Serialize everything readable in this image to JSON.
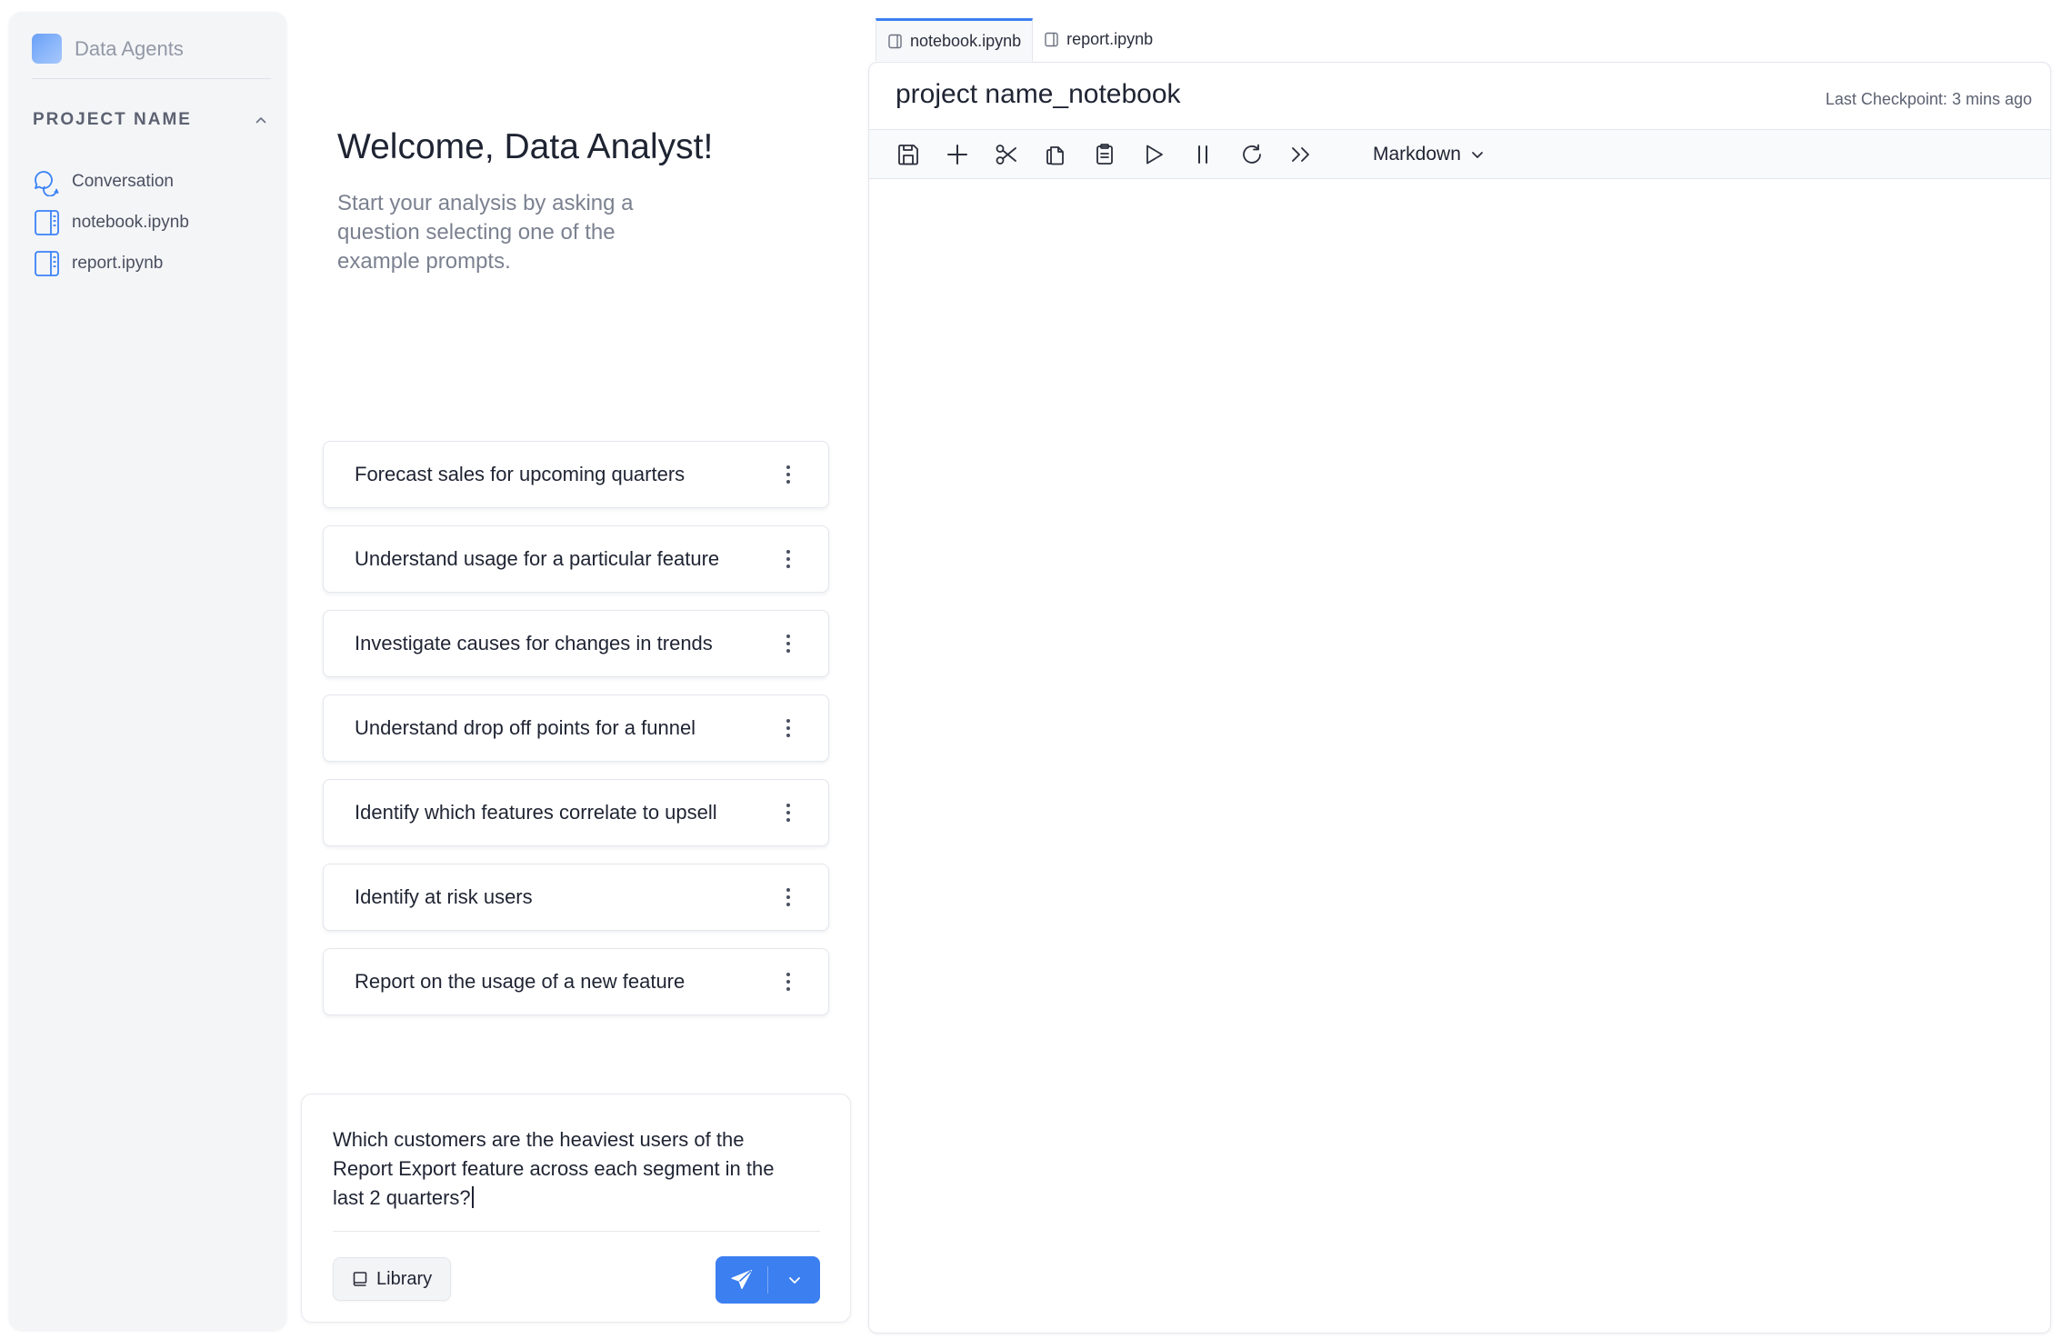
{
  "sidebar": {
    "brand": "Data Agents",
    "project_name": "PROJECT NAME",
    "items": [
      {
        "label": "Conversation",
        "icon": "chat-bubbles-icon"
      },
      {
        "label": "notebook.ipynb",
        "icon": "notebook-icon"
      },
      {
        "label": "report.ipynb",
        "icon": "notebook-icon"
      }
    ]
  },
  "conversation": {
    "title": "Welcome, Data Analyst!",
    "subtitle": "Start your analysis by asking a question selecting one of the example prompts.",
    "prompts": [
      "Forecast sales for upcoming quarters",
      "Understand usage for a particular feature",
      "Investigate causes for changes in trends",
      "Understand drop off points for a funnel",
      "Identify which features correlate to upsell",
      "Identify at risk users",
      "Report on the usage of a new feature"
    ],
    "composer": {
      "value": "Which customers are the heaviest users of the Report Export feature across each segment in the last 2 quarters?",
      "library_label": "Library"
    }
  },
  "notebook": {
    "tabs": [
      "notebook.ipynb",
      "report.ipynb"
    ],
    "active_tab": "notebook.ipynb",
    "title": "project name_notebook",
    "checkpoint": "Last Checkpoint: 3 mins ago",
    "toolbar": [
      "save-icon",
      "plus-icon",
      "scissors-icon",
      "copy-icon",
      "clipboard-icon",
      "play-icon",
      "pause-icon",
      "restart-icon",
      "fast-forward-icon"
    ],
    "cell_type": "Markdown"
  },
  "colors": {
    "accent": "#3b7ff0",
    "sidebar_bg": "#f4f5f7",
    "text": "#1f2433",
    "muted": "#7b8190"
  }
}
